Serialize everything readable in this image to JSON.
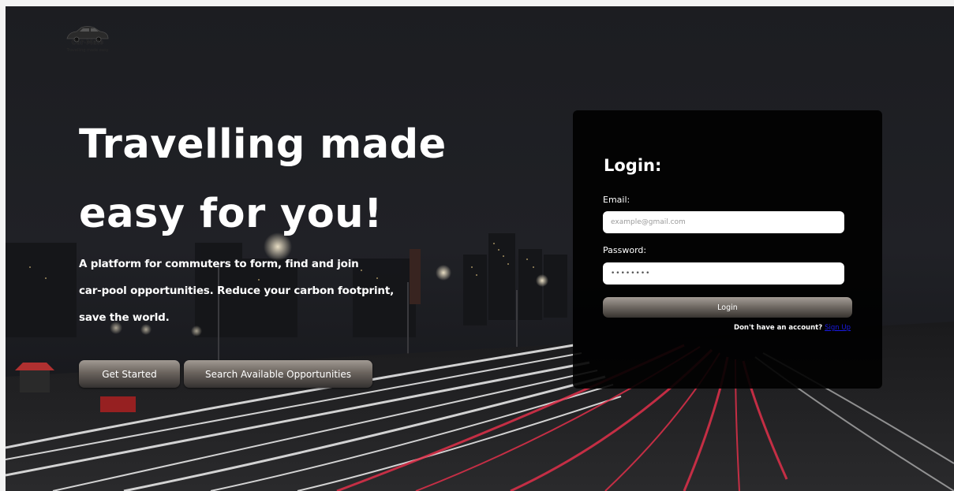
{
  "brand": {
    "name": "Car-Mate",
    "tagline": "Travelling made easy"
  },
  "hero": {
    "title_line1": "Travelling made",
    "title_line2": "easy for you!",
    "desc_line1": "A platform for commuters to form, find and join",
    "desc_line2": "car-pool opportunities. Reduce your carbon footprint,",
    "desc_line3": "save the world.",
    "get_started_label": "Get Started",
    "search_label": "Search Available Opportunities"
  },
  "login": {
    "title": "Login:",
    "email_label": "Email:",
    "email_placeholder": "example@gmail.com",
    "password_label": "Password:",
    "password_value": "••••••••",
    "submit_label": "Login",
    "no_account_text": "Don't have an account?",
    "signup_label": "Sign Up"
  },
  "colors": {
    "card_bg": "#000000",
    "button_gradient_top": "#a19a93",
    "button_gradient_bottom": "#343130",
    "link": "#1a1ae6",
    "accent_trails": "#e0304a"
  },
  "icons": {
    "logo": "car-logo-icon"
  }
}
